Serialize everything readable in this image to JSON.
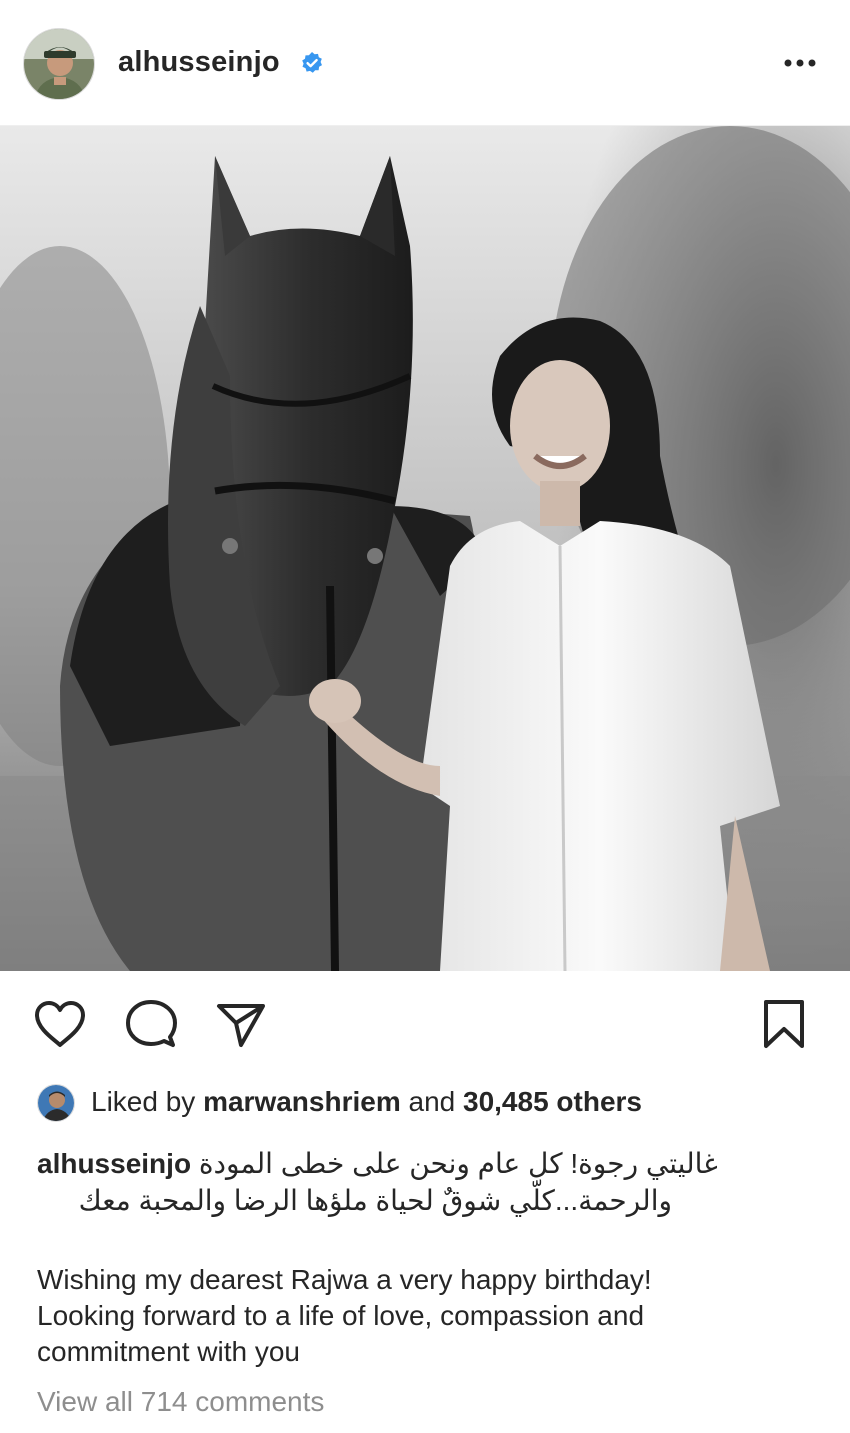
{
  "header": {
    "username": "alhusseinjo",
    "verified_color": "#3897f0"
  },
  "post": {
    "image_description_icon": "photo-woman-with-horse"
  },
  "actions": {
    "icons": [
      "heart-icon",
      "comment-icon",
      "share-icon",
      "bookmark-icon"
    ]
  },
  "likes": {
    "prefix": "Liked by",
    "liker": "marwanshriem",
    "connector": "and",
    "others": "30,485 others"
  },
  "caption": {
    "username": "alhusseinjo",
    "arabic_line1": "غاليتي رجوة! كل عام ونحن على خطى المودة",
    "arabic_line2": "والرحمة...كلّي شوقٌ لحياة ملؤها الرضا والمحبة معك",
    "english_line1": "Wishing my dearest Rajwa a very happy birthday!",
    "english_line2": "Looking forward to a life of love, compassion and",
    "english_line3": "commitment with you"
  },
  "comments": {
    "view_all": "View all 714 comments"
  }
}
